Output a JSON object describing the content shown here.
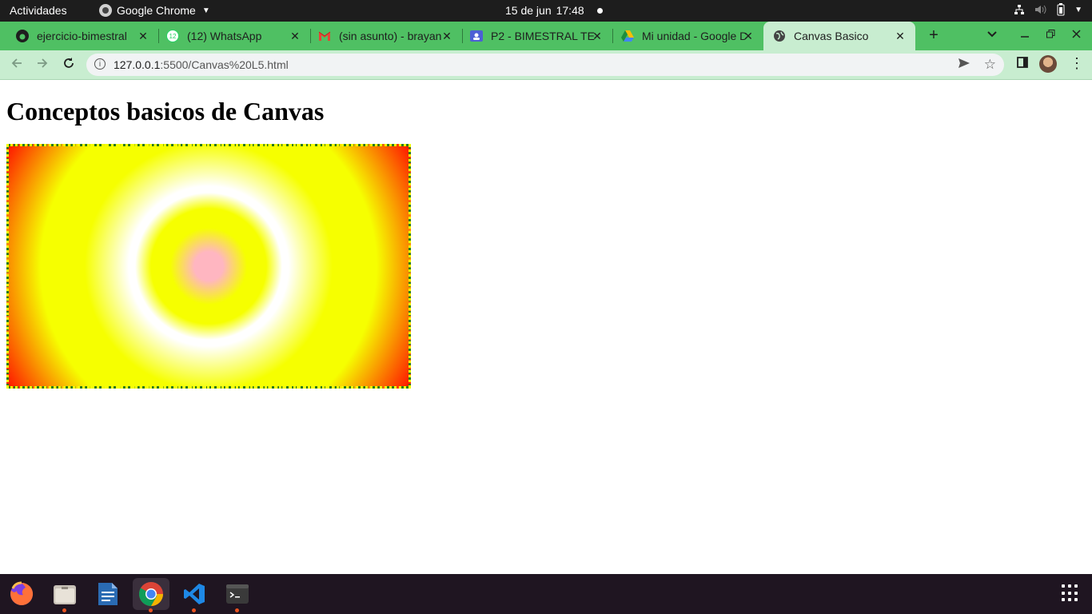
{
  "topbar": {
    "activities": "Actividades",
    "app_name": "Google Chrome",
    "date": "15 de jun",
    "time": "17:48"
  },
  "tabs": [
    {
      "title": "ejercicio-bimestral",
      "icon": "github-icon"
    },
    {
      "title": "(12) WhatsApp",
      "icon": "whatsapp-icon",
      "badge": "12"
    },
    {
      "title": "(sin asunto) - brayan",
      "icon": "gmail-icon"
    },
    {
      "title": "P2 - BIMESTRAL TE",
      "icon": "classroom-icon"
    },
    {
      "title": "Mi unidad - Google Drive",
      "icon": "drive-icon"
    },
    {
      "title": "Canvas Basico",
      "icon": "globe-icon",
      "active": true
    }
  ],
  "toolbar": {
    "url_host": "127.0.0.1",
    "url_rest": ":5500/Canvas%20L5.html"
  },
  "page": {
    "heading": "Conceptos basicos de Canvas",
    "canvas_colors": {
      "center": "#ffb6c1",
      "ring_yellow": "#f6ff00",
      "ring_white": "#ffffff",
      "edge": "#ff0000",
      "border": "#2a7a1a"
    }
  },
  "dock": {
    "apps": [
      {
        "name": "firefox-icon",
        "running": false
      },
      {
        "name": "files-icon",
        "running": true
      },
      {
        "name": "writer-icon",
        "running": false
      },
      {
        "name": "chrome-icon",
        "running": true,
        "active": true
      },
      {
        "name": "vscode-icon",
        "running": true
      },
      {
        "name": "terminal-icon",
        "running": true
      }
    ]
  }
}
